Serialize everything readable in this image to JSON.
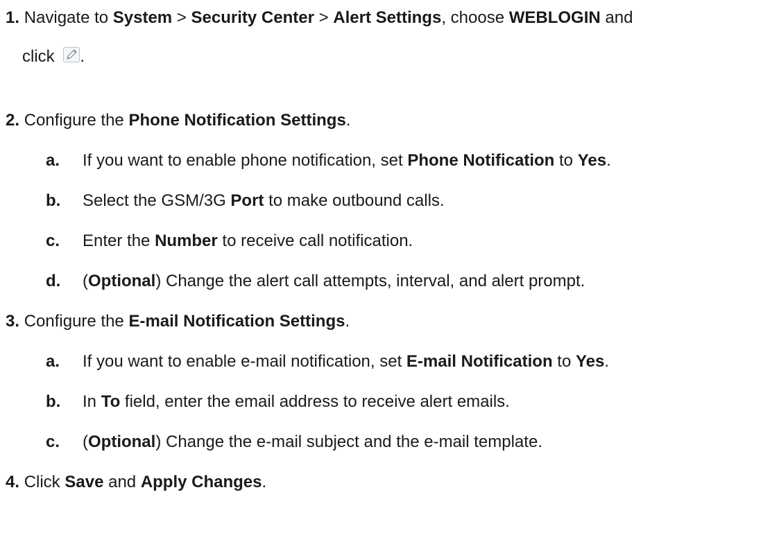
{
  "steps": [
    {
      "number": "1.",
      "parts": [
        "Navigate to ",
        "System",
        " > ",
        "Security Center",
        " > ",
        "Alert Settings",
        ", choose ",
        "WEBLOGIN",
        " and"
      ],
      "cont": [
        "click",
        "."
      ]
    },
    {
      "number": "2.",
      "parts": [
        "Configure the ",
        "Phone Notification Settings",
        "."
      ],
      "subs": [
        {
          "letter": "a.",
          "parts": [
            "If you want to enable phone notification, set ",
            "Phone Notification",
            " to ",
            "Yes",
            "."
          ]
        },
        {
          "letter": "b.",
          "parts": [
            "Select the GSM/3G ",
            "Port",
            " to make outbound calls."
          ]
        },
        {
          "letter": "c.",
          "parts": [
            "Enter the ",
            "Number",
            " to receive call notification."
          ]
        },
        {
          "letter": "d.",
          "parts": [
            "(",
            "Optional",
            ") Change the alert call attempts, interval, and alert prompt."
          ]
        }
      ]
    },
    {
      "number": "3.",
      "parts": [
        "Configure the ",
        "E-mail Notification Settings",
        "."
      ],
      "subs": [
        {
          "letter": "a.",
          "parts": [
            "If you want to enable e-mail notification, set ",
            "E-mail Notification",
            " to ",
            "Yes",
            "."
          ]
        },
        {
          "letter": "b.",
          "parts": [
            "In ",
            "To",
            " field, enter the email address to receive alert emails."
          ]
        },
        {
          "letter": "c.",
          "parts": [
            "(",
            "Optional",
            ") Change the e-mail subject and the e-mail template."
          ]
        }
      ]
    },
    {
      "number": "4.",
      "parts": [
        "Click ",
        "Save",
        " and ",
        "Apply Changes",
        "."
      ]
    }
  ],
  "icons": {
    "edit": "pencil-edit-icon"
  }
}
